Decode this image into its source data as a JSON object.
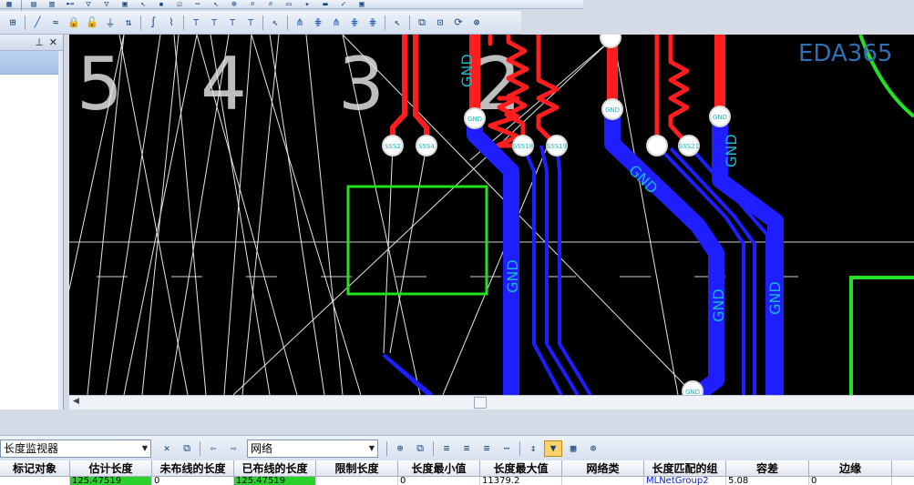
{
  "canvas": {
    "zone_numbers": [
      "5",
      "4",
      "3",
      "2"
    ],
    "net_labels": {
      "gnd": "GND",
      "pad_a": "SSS2",
      "pad_b": "SSS4",
      "pad_c": "SSS18",
      "pad_d": "SSS19",
      "pad_e": "SSS21"
    }
  },
  "logo": {
    "text": "EDA365"
  },
  "monitor": {
    "title_combo": "长度监视器",
    "filter_combo": "网络",
    "columns": [
      "标记对象",
      "估计长度",
      "未布线的长度",
      "已布线的长度",
      "限制长度",
      "长度最小值",
      "长度最大值",
      "网络类",
      "长度匹配的组",
      "容差",
      "边缘"
    ],
    "row": [
      "",
      "125.47519",
      "0",
      "125.47519",
      "",
      "0",
      "11379.2",
      "",
      "MLNetGroup2",
      "5.08",
      "0"
    ]
  },
  "colors": {
    "top_trace": "#ff1e1e",
    "bottom_trace": "#1e1eff",
    "gnd_label": "#1ab8c8",
    "highlight_box": "#22e022",
    "ratsnest": "#e6e6e6",
    "canvas_bg": "#000000",
    "estimate_fill": "#2bd12b"
  },
  "icons": [
    "select-icon",
    "route-icon",
    "lock-icon",
    "flip-icon",
    "zoom-icon",
    "cut-icon",
    "filter-icon",
    "find-icon",
    "sort-icon",
    "close-icon",
    "pin-icon",
    "left-arrow-icon",
    "right-arrow-icon"
  ]
}
